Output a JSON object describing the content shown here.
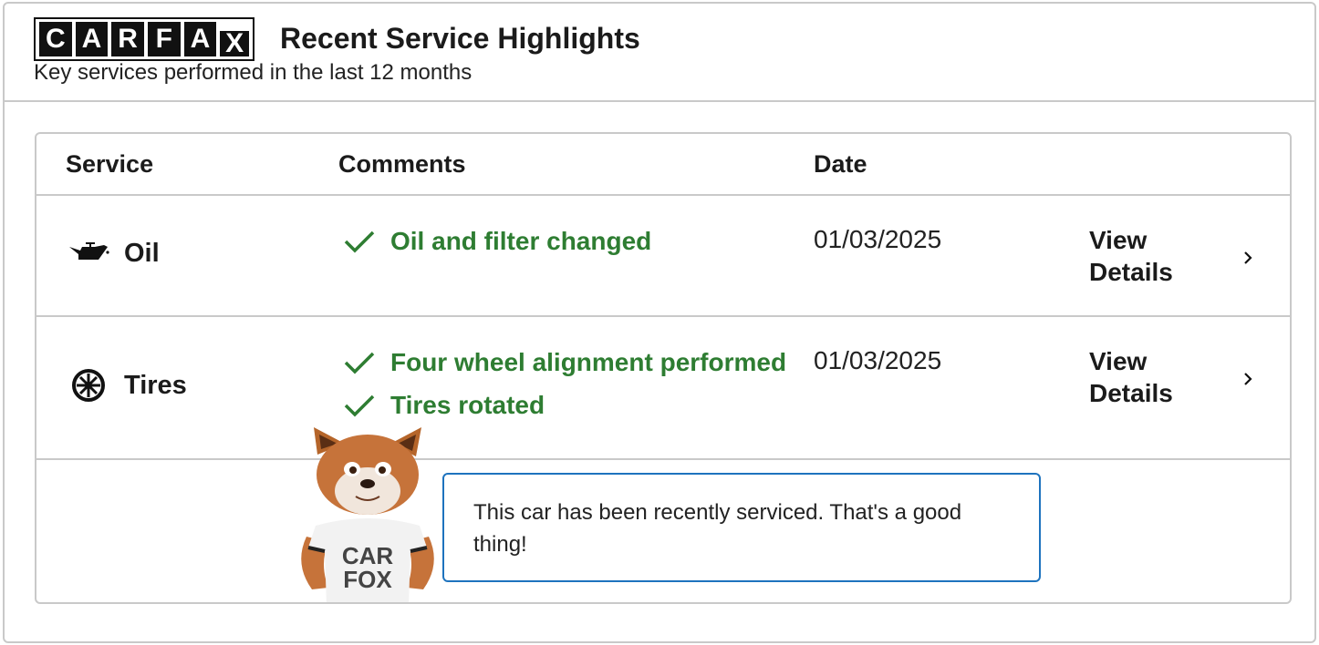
{
  "header": {
    "logo_letters": [
      "C",
      "A",
      "R",
      "F",
      "A",
      "X"
    ],
    "title": "Recent Service Highlights",
    "subtitle": "Key services performed in the last 12 months"
  },
  "table": {
    "columns": {
      "service": "Service",
      "comments": "Comments",
      "date": "Date"
    },
    "rows": [
      {
        "service": "Oil",
        "icon": "oil-can-icon",
        "comments": [
          "Oil and filter changed"
        ],
        "date": "01/03/2025",
        "action_line1": "View",
        "action_line2": "Details"
      },
      {
        "service": "Tires",
        "icon": "tire-icon",
        "comments": [
          "Four wheel alignment performed",
          "Tires rotated"
        ],
        "date": "01/03/2025",
        "action_line1": "View",
        "action_line2": "Details"
      }
    ]
  },
  "mascot": {
    "shirt_line1": "CAR",
    "shirt_line2": "FOX",
    "message": "This car has been recently serviced. That's a good thing!"
  },
  "colors": {
    "accent_green": "#2e7d32",
    "bubble_border": "#1e73be",
    "border": "#c9c9c9"
  }
}
